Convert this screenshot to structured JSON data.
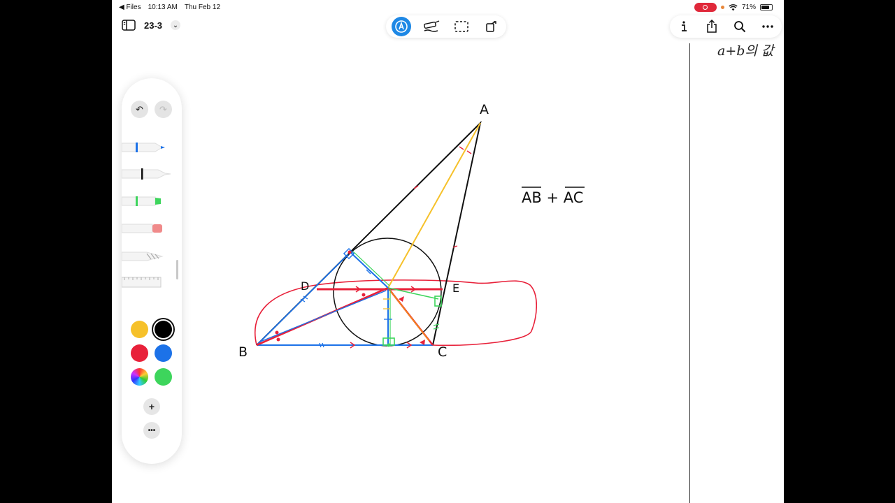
{
  "status_bar": {
    "back_app": "◀ Files",
    "time": "10:13 AM",
    "date": "Thu Feb 12",
    "battery": "71%"
  },
  "document": {
    "title": "23-3",
    "side_note": "a+b의 값"
  },
  "toolbar": {
    "modes": [
      "pencil-mode-icon",
      "highlighter-mode-icon",
      "lasso-select-icon",
      "shape-icon"
    ],
    "actions": [
      "info-icon",
      "share-icon",
      "search-icon",
      "more-icon"
    ]
  },
  "palette": {
    "tools": [
      "pen",
      "fineliner",
      "marker",
      "eraser",
      "pencil",
      "ruler"
    ],
    "colors": [
      "#f6c12a",
      "#000000",
      "#e8213a",
      "#1c72e8",
      "multicolor",
      "#3dd55c"
    ],
    "selected_color": "#000000",
    "add_label": "+",
    "more_label": "•••"
  },
  "canvas": {
    "labels": {
      "A": "A",
      "B": "B",
      "C": "C",
      "D": "D",
      "E": "E"
    },
    "expression": "AB + AC"
  }
}
